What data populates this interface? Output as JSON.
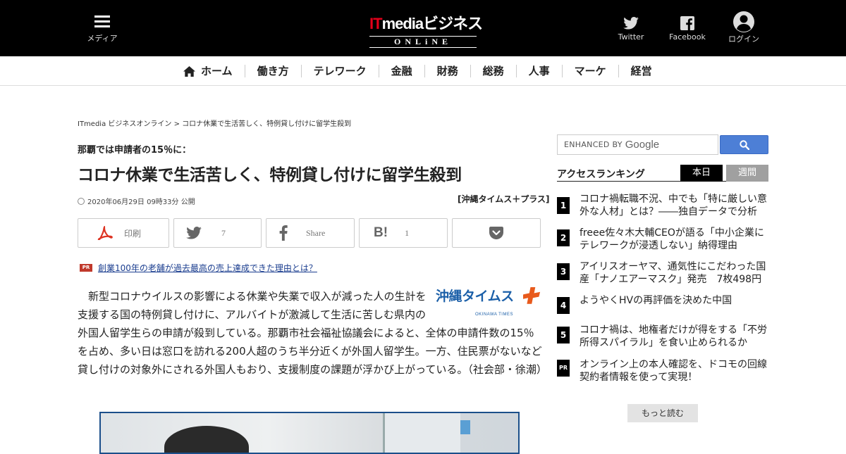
{
  "header": {
    "menu_label": "メディア",
    "logo": {
      "it": "IT",
      "rest": "mediaビジネス",
      "sub": "ONLiNE"
    },
    "twitter_label": "Twitter",
    "facebook_label": "Facebook",
    "login_label": "ログイン",
    "colors": {
      "background": "#000000",
      "logo_accent": "#e2001a"
    }
  },
  "nav": {
    "items": [
      {
        "label": "ホーム",
        "icon": "home-icon"
      },
      {
        "label": "働き方"
      },
      {
        "label": "テレワーク"
      },
      {
        "label": "金融"
      },
      {
        "label": "財務"
      },
      {
        "label": "総務"
      },
      {
        "label": "人事"
      },
      {
        "label": "マーケ"
      },
      {
        "label": "経営"
      }
    ]
  },
  "article": {
    "breadcrumb": {
      "home": "ITmedia ビジネスオンライン",
      "sep": " > ",
      "current": "コロナ休業で生活苦しく、特例貸し付けに留学生殺到"
    },
    "subtitle": "那覇では申請者の15％に：",
    "title": "コロナ休業で生活苦しく、特例貸し付けに留学生殺到",
    "date": "2020年06月29日 09時33分 公開",
    "source": "[沖縄タイムス＋プラス]",
    "share": {
      "print": "印刷",
      "twitter_count": "7",
      "facebook": "Share",
      "hatena_count": "1"
    },
    "pr": {
      "badge": "PR",
      "text": "創業100年の老舗が過去最高の売上達成できた理由とは？"
    },
    "publisher_logo": {
      "jp": "沖縄タイムス",
      "en": "OKINAWA TIMES",
      "plus": "プラス"
    },
    "body": "新型コロナウイルスの影響による休業や失業で収入が減った人の生計を支援する国の特例貸し付けに、アルバイトが激減して生活に苦しむ県内の外国人留学生らの申請が殺到している。那覇市社会福祉協議会によると、全体の申請件数の15％を占め、多い日は窓口を訪れる200人超のうち半分近くが外国人留学生。一方、住民票がないなど貸し付けの対象外にされる外国人もおり、支援制度の課題が浮かび上がっている。（社会部・徐潮）"
  },
  "sidebar": {
    "search": {
      "placeholder_prefix": "ENHANCED BY",
      "google": "Google"
    },
    "ranking": {
      "title": "アクセスランキング",
      "tab_day": "本日",
      "tab_week": "週間",
      "items": [
        {
          "num": "1",
          "text": "コロナ禍転職不況、中でも「特に厳しい意外な人材」とは？――独自データで分析"
        },
        {
          "num": "2",
          "text": "freee佐々木大輔CEOが語る「中小企業にテレワークが浸透しない」納得理由"
        },
        {
          "num": "3",
          "text": "アイリスオーヤマ、通気性にこだわった国産「ナノエアーマスク」発売　7枚498円"
        },
        {
          "num": "4",
          "text": "ようやくHVの再評価を決めた中国"
        },
        {
          "num": "5",
          "text": "コロナ禍は、地権者だけが得をする「不労所得スパイラル」を食い止められるか"
        },
        {
          "num": "PR",
          "text": "オンライン上の本人確認を、ドコモの回線契約者情報を使って実現！"
        }
      ],
      "more": "もっと読む"
    }
  }
}
